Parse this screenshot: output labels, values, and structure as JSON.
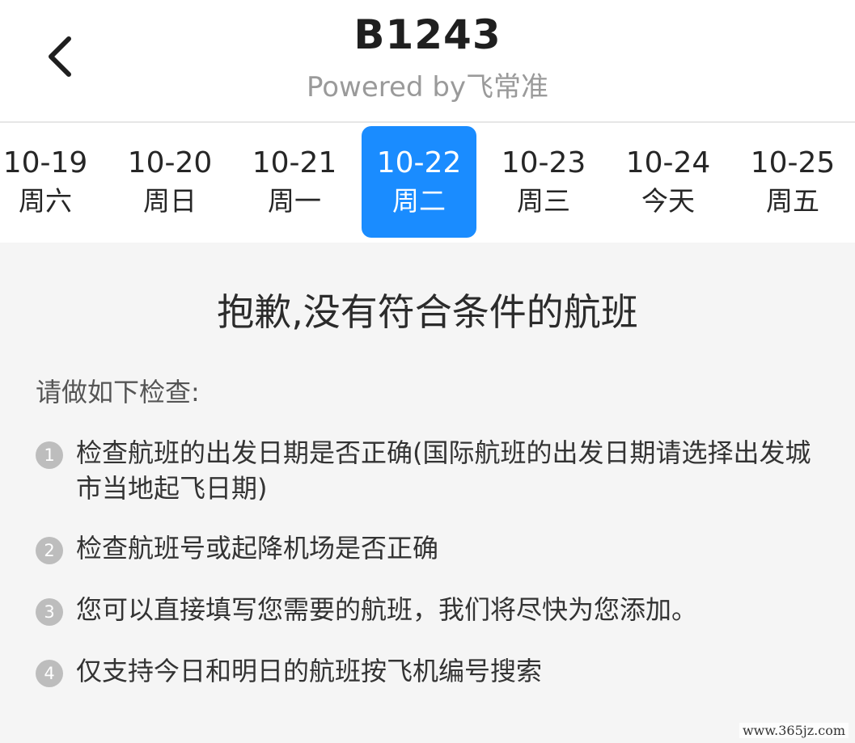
{
  "header": {
    "title": "B1243",
    "subtitle": "Powered by飞常准",
    "back_icon": "chevron-left-icon"
  },
  "dates": [
    {
      "date": "10-19",
      "weekday": "周六",
      "selected": false
    },
    {
      "date": "10-20",
      "weekday": "周日",
      "selected": false
    },
    {
      "date": "10-21",
      "weekday": "周一",
      "selected": false
    },
    {
      "date": "10-22",
      "weekday": "周二",
      "selected": true
    },
    {
      "date": "10-23",
      "weekday": "周三",
      "selected": false
    },
    {
      "date": "10-24",
      "weekday": "今天",
      "selected": false
    },
    {
      "date": "10-25",
      "weekday": "周五",
      "selected": false
    }
  ],
  "colors": {
    "accent": "#1a8cff",
    "content_bg": "#f5f5f5"
  },
  "empty_state": {
    "title": "抱歉,没有符合条件的航班",
    "heading": "请做如下检查:",
    "items": [
      {
        "number": "1",
        "text": "检查航班的出发日期是否正确(国际航班的出发日期请选择出发城市当地起飞日期)"
      },
      {
        "number": "2",
        "text": "检查航班号或起降机场是否正确"
      },
      {
        "number": "3",
        "text": "您可以直接填写您需要的航班，我们将尽快为您添加。"
      },
      {
        "number": "4",
        "text": "仅支持今日和明日的航班按飞机编号搜索"
      }
    ]
  },
  "watermark": "www.365jz.com"
}
